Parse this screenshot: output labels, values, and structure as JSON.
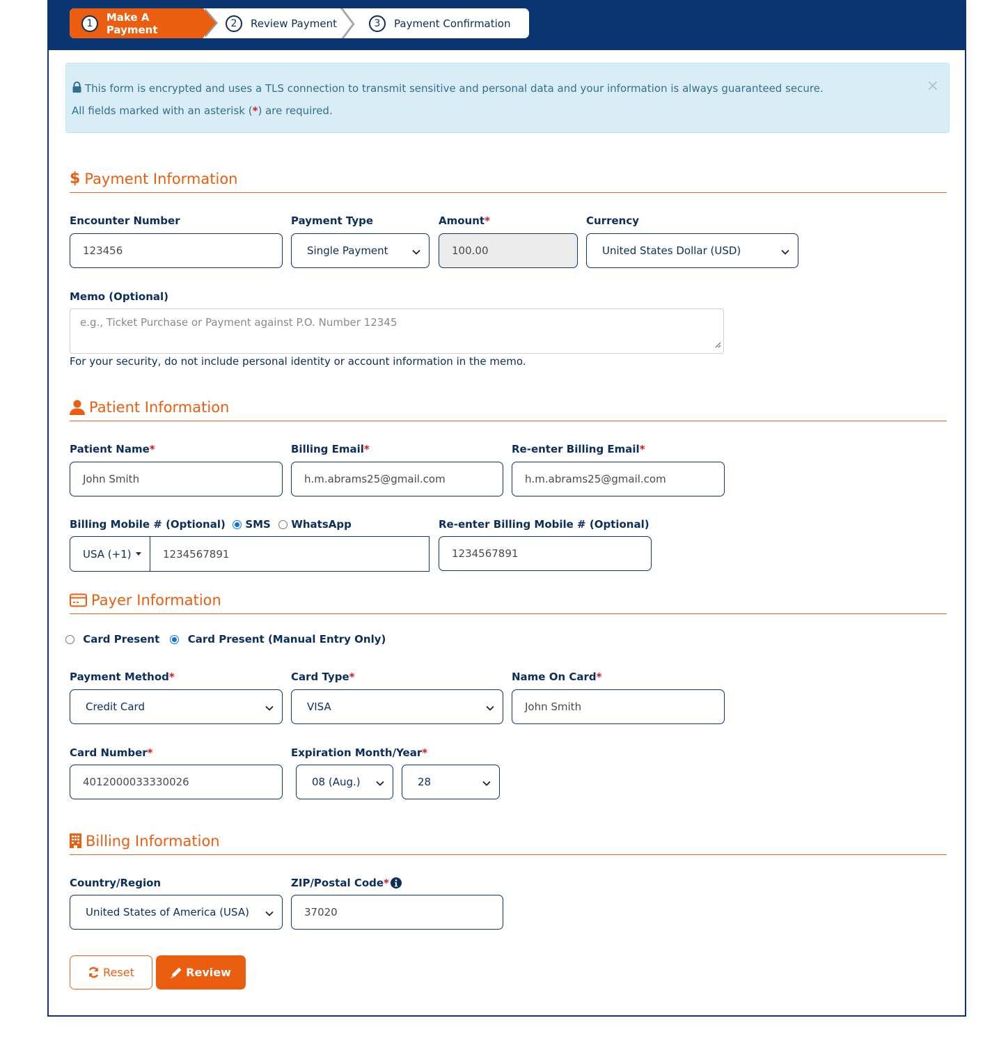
{
  "stepper": {
    "steps": [
      {
        "number": "1",
        "label": "Make A Payment",
        "active": true
      },
      {
        "number": "2",
        "label": "Review Payment",
        "active": false
      },
      {
        "number": "3",
        "label": "Payment Confirmation",
        "active": false
      }
    ]
  },
  "alert": {
    "icon": "lock-icon",
    "line1": "This form is encrypted and uses a TLS connection to transmit sensitive and personal data and your information is always guaranteed secure.",
    "line2_prefix": "All fields marked with an asterisk (",
    "line2_asterisk": "*",
    "line2_suffix": ") are required.",
    "close": "×"
  },
  "colors": {
    "brand_navy": "#0a3570",
    "accent_orange": "#ec5e0f",
    "required_red": "#e0141e",
    "alert_bg": "#d9edf7"
  },
  "payment_info": {
    "title": "Payment Information",
    "icon": "dollar-icon",
    "encounter_number": {
      "label": "Encounter Number",
      "value": "123456"
    },
    "payment_type": {
      "label": "Payment Type",
      "value": "Single Payment"
    },
    "amount": {
      "label": "Amount",
      "required": "*",
      "value": "100.00"
    },
    "currency": {
      "label": "Currency",
      "value": "United States Dollar (USD)"
    },
    "memo": {
      "label": "Memo (Optional)",
      "placeholder": "e.g., Ticket Purchase or Payment against P.O. Number 12345",
      "help": "For your security, do not include personal identity or account information in the memo."
    }
  },
  "patient_info": {
    "title": "Patient Information",
    "icon": "user-icon",
    "patient_name": {
      "label": "Patient Name",
      "required": "*",
      "value": "John Smith"
    },
    "billing_email": {
      "label": "Billing Email",
      "required": "*",
      "value": "h.m.abrams25@gmail.com"
    },
    "reenter_email": {
      "label": "Re-enter Billing Email",
      "required": "*",
      "value": "h.m.abrams25@gmail.com"
    },
    "billing_mobile": {
      "label": "Billing Mobile # (Optional)",
      "options": [
        {
          "label": "SMS",
          "checked": true
        },
        {
          "label": "WhatsApp",
          "checked": false
        }
      ],
      "country_code": "USA (+1)",
      "value": "1234567891"
    },
    "reenter_mobile": {
      "label": "Re-enter Billing Mobile # (Optional)",
      "value": "1234567891"
    }
  },
  "payer_info": {
    "title": "Payer Information",
    "icon": "credit-card-icon",
    "card_mode_options": [
      {
        "label": "Card Present",
        "checked": false
      },
      {
        "label": "Card Present (Manual Entry Only)",
        "checked": true
      }
    ],
    "payment_method": {
      "label": "Payment Method",
      "required": "*",
      "value": "Credit Card"
    },
    "card_type": {
      "label": "Card Type",
      "required": "*",
      "value": "VISA"
    },
    "name_on_card": {
      "label": "Name On Card",
      "required": "*",
      "value": "John Smith"
    },
    "card_number": {
      "label": "Card Number",
      "required": "*",
      "value": "4012000033330026"
    },
    "expiration": {
      "label": "Expiration Month/Year",
      "required": "*",
      "month": "08 (Aug.)",
      "year": "28"
    }
  },
  "billing_info": {
    "title": "Billing Information",
    "icon": "building-icon",
    "country": {
      "label": "Country/Region",
      "value": "United States of America (USA)"
    },
    "zip": {
      "label": "ZIP/Postal Code",
      "required": "*",
      "value": "37020"
    }
  },
  "actions": {
    "reset_label": "Reset",
    "review_label": "Review"
  }
}
